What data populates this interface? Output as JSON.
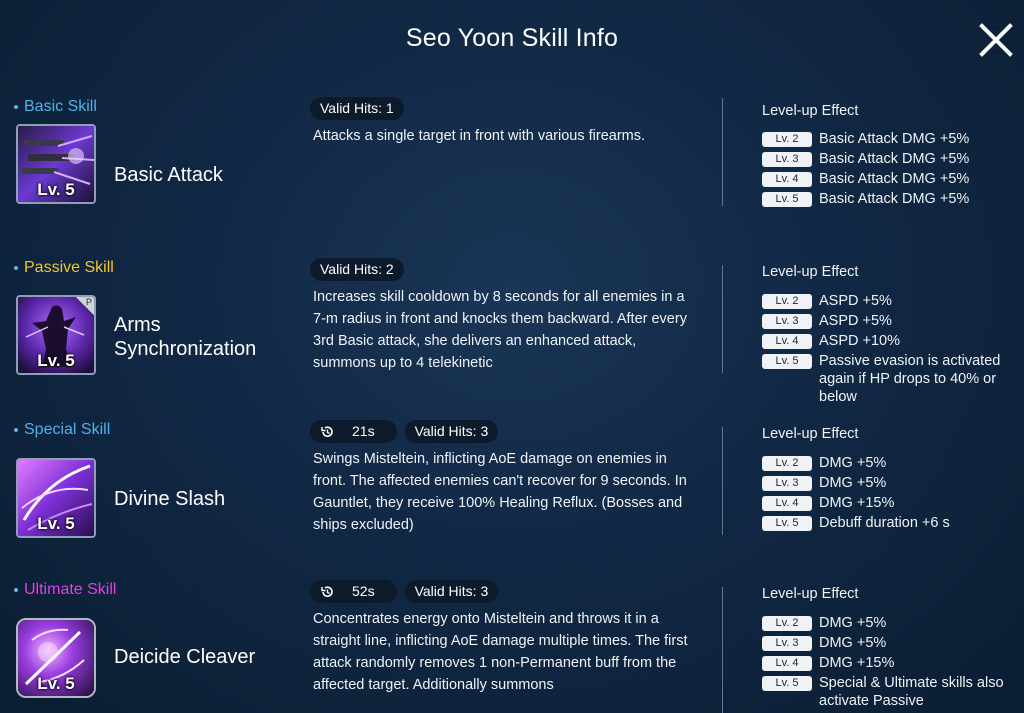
{
  "title": "Seo Yoon Skill Info",
  "close_label": "Close",
  "colors": {
    "basic": "#4fb2e8",
    "passive": "#f1c432",
    "special": "#4fb2e8",
    "ultimate": "#e040e8"
  },
  "skills": [
    {
      "category": "Basic Skill",
      "name": "Basic Attack",
      "level": "Lv. 5",
      "icon": "firearms-icon",
      "cooldown": "",
      "valid_hits": "Valid Hits: 1",
      "description": "Attacks a single target in front with various firearms.",
      "level_title": "Level-up Effect",
      "effects": [
        {
          "lv": "Lv. 2",
          "text": "Basic Attack DMG +5%"
        },
        {
          "lv": "Lv. 3",
          "text": "Basic Attack DMG +5%"
        },
        {
          "lv": "Lv. 4",
          "text": "Basic Attack DMG +5%"
        },
        {
          "lv": "Lv. 5",
          "text": "Basic Attack DMG +5%"
        }
      ]
    },
    {
      "category": "Passive Skill",
      "name": "Arms Synchronization",
      "level": "Lv. 5",
      "icon": "silhouette-icon",
      "passive_badge": "P",
      "cooldown": "",
      "valid_hits": "Valid Hits: 2",
      "description": "Increases skill cooldown by 8 seconds for all enemies in a 7-m radius in front and knocks them backward. After every 3rd Basic attack, she delivers an enhanced attack, summons up to 4 telekinetic",
      "level_title": "Level-up Effect",
      "effects": [
        {
          "lv": "Lv. 2",
          "text": "ASPD +5%"
        },
        {
          "lv": "Lv. 3",
          "text": "ASPD +5%"
        },
        {
          "lv": "Lv. 4",
          "text": "ASPD +10%"
        },
        {
          "lv": "Lv. 5",
          "text": "Passive evasion is activated again if HP drops to 40% or below"
        }
      ]
    },
    {
      "category": "Special Skill",
      "name": "Divine Slash",
      "level": "Lv. 5",
      "icon": "slash-icon",
      "cooldown": "21s",
      "valid_hits": "Valid Hits: 3",
      "description": "Swings Misteltein, inflicting AoE damage on enemies in front. The affected enemies can't recover for 9 seconds. In Gauntlet, they receive 100% Healing Reflux. (Bosses and ships excluded)",
      "level_title": "Level-up Effect",
      "effects": [
        {
          "lv": "Lv. 2",
          "text": "DMG +5%"
        },
        {
          "lv": "Lv. 3",
          "text": "DMG +5%"
        },
        {
          "lv": "Lv. 4",
          "text": "DMG +15%"
        },
        {
          "lv": "Lv. 5",
          "text": "Debuff duration +6 s"
        }
      ]
    },
    {
      "category": "Ultimate Skill",
      "name": "Deicide Cleaver",
      "level": "Lv. 5",
      "icon": "cleaver-icon",
      "cooldown": "52s",
      "valid_hits": "Valid Hits: 3",
      "description": "Concentrates energy onto Misteltein and throws it in a straight line, inflicting AoE damage multiple times. The first attack randomly removes 1 non-Permanent buff from the affected target. Additionally summons",
      "level_title": "Level-up Effect",
      "effects": [
        {
          "lv": "Lv. 2",
          "text": "DMG +5%"
        },
        {
          "lv": "Lv. 3",
          "text": "DMG +5%"
        },
        {
          "lv": "Lv. 4",
          "text": "DMG +15%"
        },
        {
          "lv": "Lv. 5",
          "text": "Special & Ultimate skills also activate Passive"
        }
      ]
    }
  ]
}
